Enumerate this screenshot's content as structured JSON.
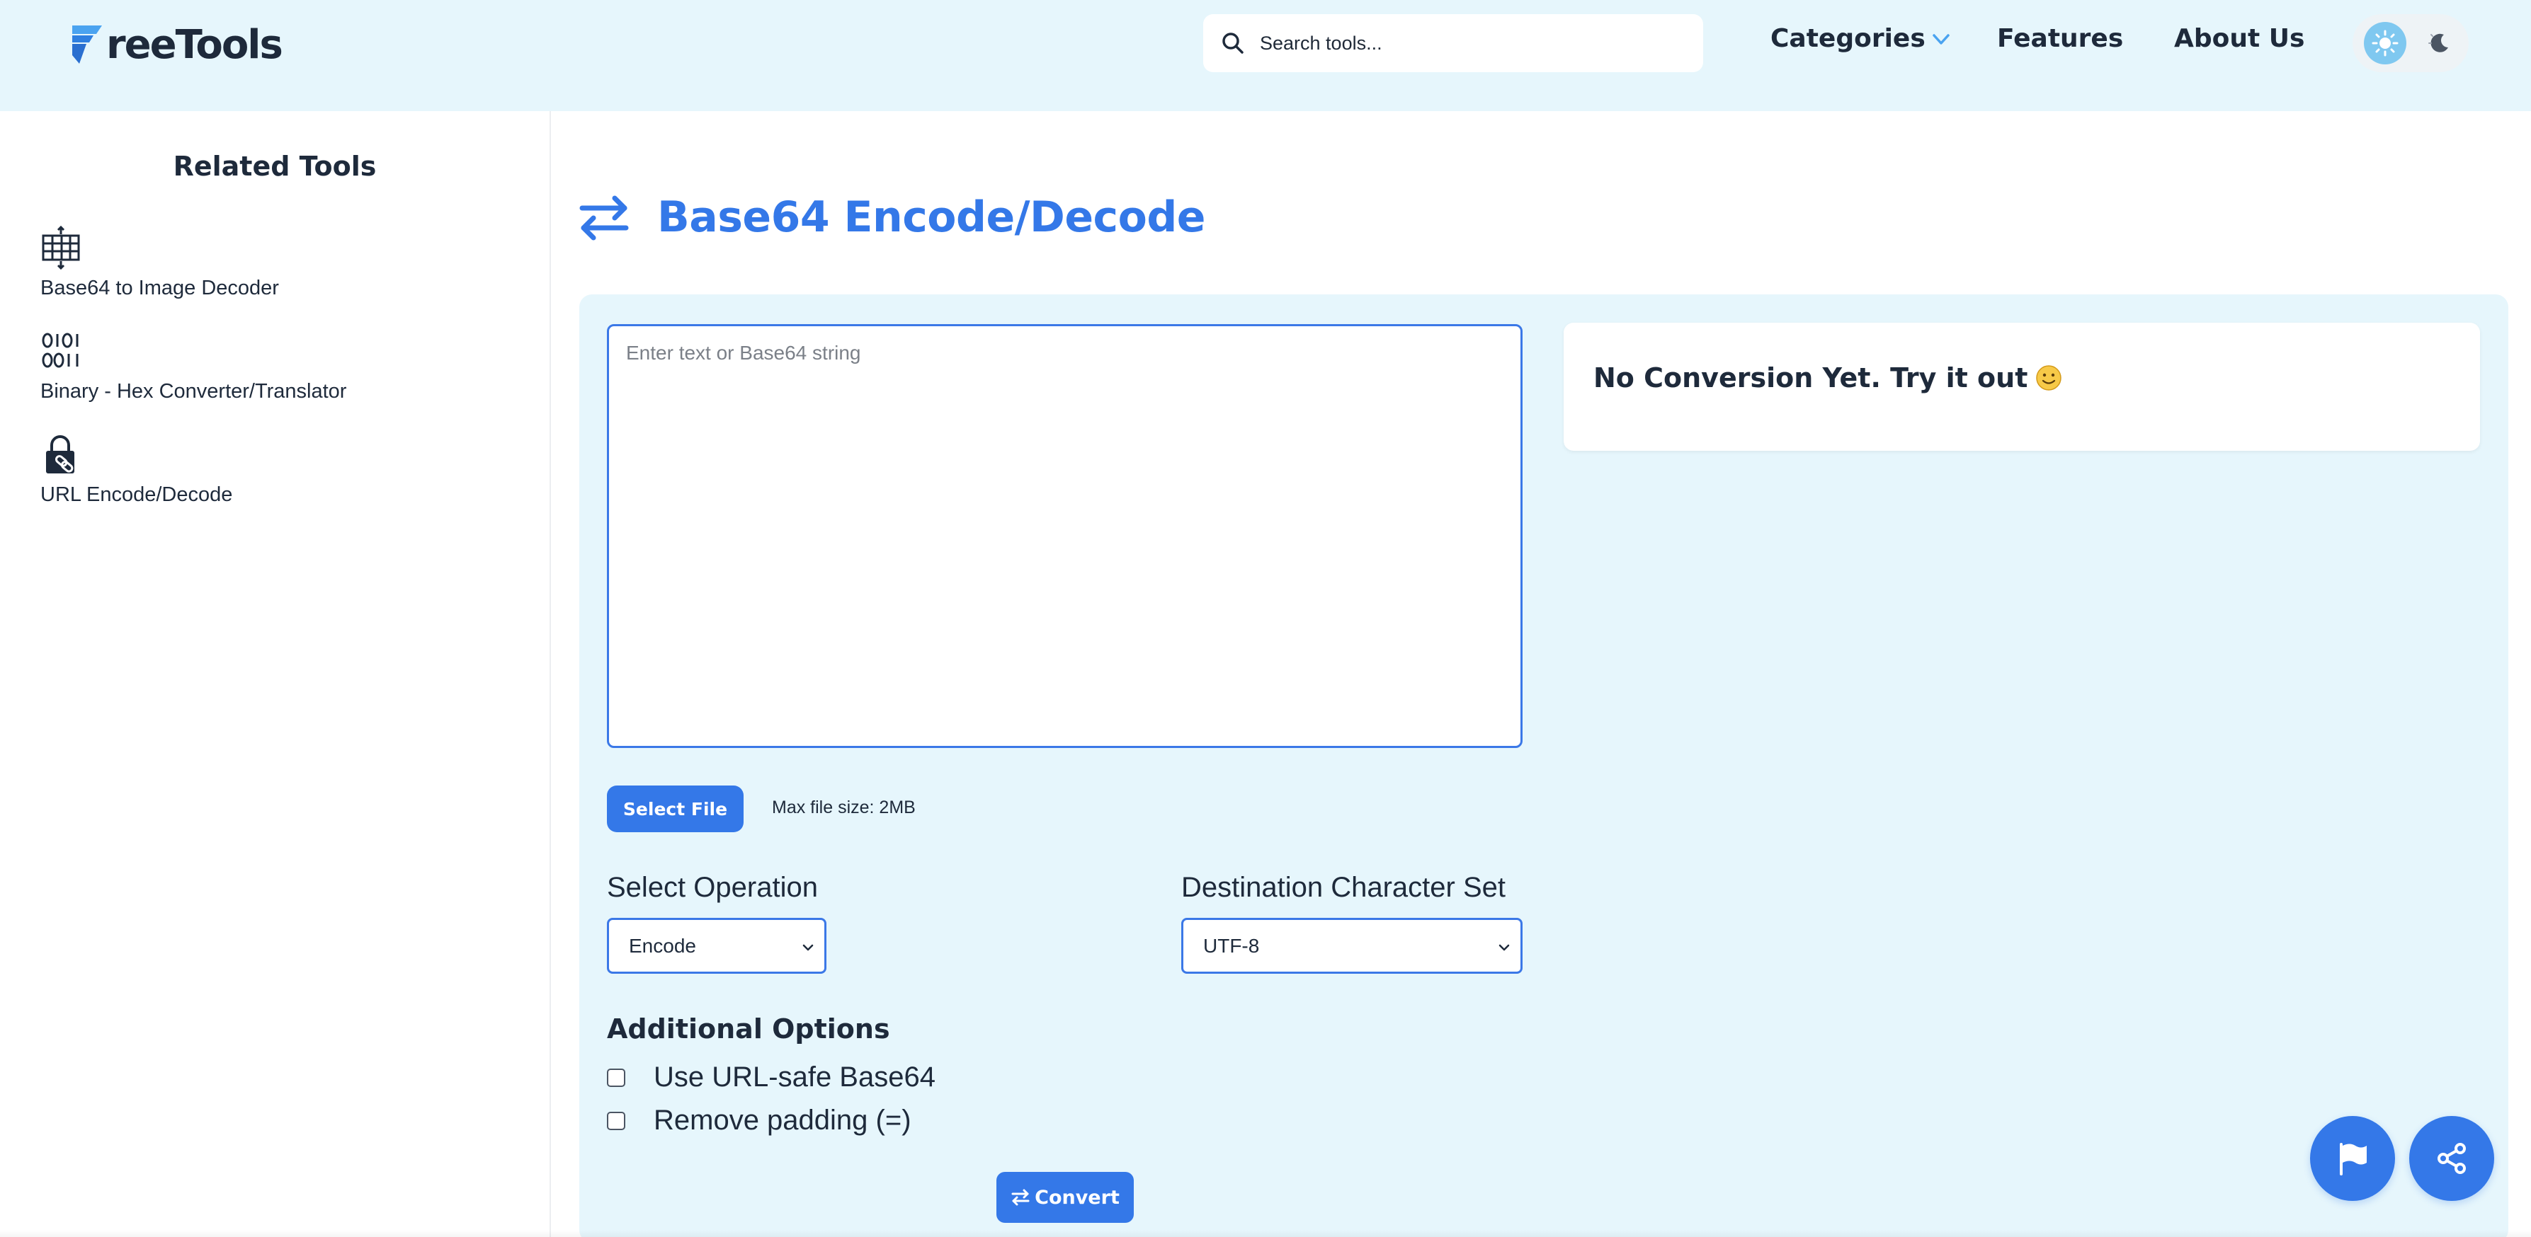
{
  "header": {
    "logo_text": "reeTools",
    "search_placeholder": "Search tools...",
    "nav": {
      "categories": "Categories",
      "features": "Features",
      "about": "About Us"
    },
    "icons": {
      "logo": "logo-f-icon",
      "search": "search-icon",
      "chevron": "chevron-down-icon",
      "sun": "sun-icon",
      "moon": "moon-icon"
    }
  },
  "sidebar": {
    "title": "Related Tools",
    "items": [
      {
        "label": "Base64 to Image Decoder",
        "icon": "image-grid-icon"
      },
      {
        "label": "Binary - Hex Converter/Translator",
        "icon": "binary-icon"
      },
      {
        "label": "URL Encode/Decode",
        "icon": "lock-link-icon"
      }
    ]
  },
  "main": {
    "title": "Base64 Encode/Decode",
    "title_icon": "swap-arrows-icon",
    "input_placeholder": "Enter text or Base64 string",
    "select_file_label": "Select File",
    "max_file_size": "Max file size: 2MB",
    "operation": {
      "label": "Select Operation",
      "selected": "Encode"
    },
    "charset": {
      "label": "Destination Character Set",
      "selected": "UTF-8"
    },
    "additional_options": {
      "title": "Additional Options",
      "options": [
        {
          "label": "Use URL-safe Base64",
          "checked": false
        },
        {
          "label": "Remove padding (=)",
          "checked": false
        }
      ]
    },
    "convert_label": "Convert",
    "result_message": "No Conversion Yet. Try it out"
  },
  "floating": {
    "flag_icon": "flag-icon",
    "share_icon": "share-icon"
  },
  "colors": {
    "accent": "#3478e8",
    "header_bg": "#e6f6fc",
    "text_dark": "#1e2a3b"
  }
}
